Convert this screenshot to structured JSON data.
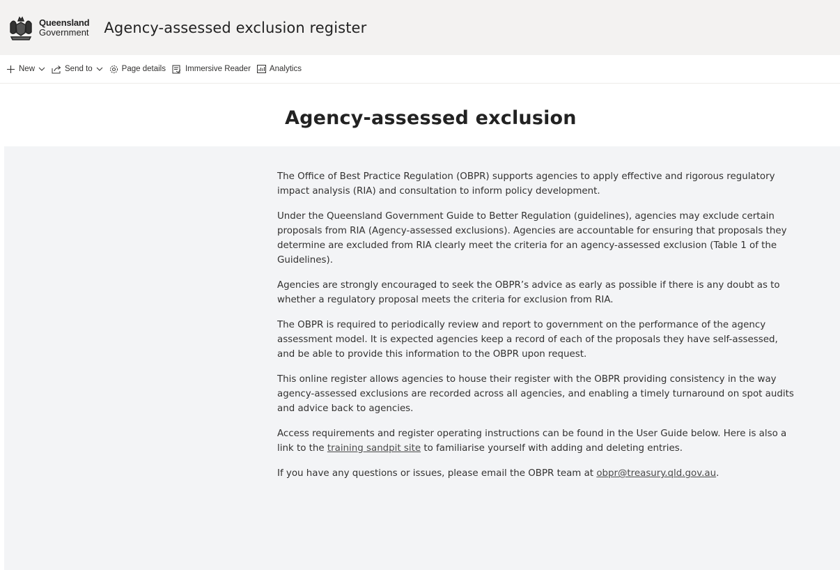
{
  "header": {
    "logo_line1": "Queensland",
    "logo_line2": "Government",
    "site_title": "Agency-assessed exclusion register"
  },
  "command_bar": {
    "new_label": "New",
    "send_to_label": "Send to",
    "page_details_label": "Page details",
    "immersive_reader_label": "Immersive Reader",
    "analytics_label": "Analytics"
  },
  "page": {
    "heading": "Agency-assessed exclusion",
    "paragraphs": [
      "The Office of Best Practice Regulation (OBPR) supports agencies to apply effective and rigorous regulatory impact analysis (RIA) and consultation to inform policy development.",
      "Under the Queensland Government Guide to Better Regulation (guidelines), agencies may exclude certain proposals from RIA (Agency-assessed exclusions). Agencies are accountable for ensuring that proposals they determine are excluded from RIA clearly meet the criteria for an agency-assessed exclusion (Table 1 of the Guidelines).",
      "Agencies are strongly encouraged to seek the OBPR’s advice as early as possible if there is any doubt as to whether a regulatory proposal meets the criteria for exclusion from RIA.",
      "The OBPR is required to periodically review and report to government on the performance of the agency assessment model. It is expected agencies keep a record of each of the proposals they have self-assessed, and be able to provide this information to the OBPR upon request.",
      "This online register allows agencies to house their register with the OBPR providing consistency in the way agency-assessed exclusions are recorded across all agencies, and enabling a timely turnaround on spot audits and advice back to agencies."
    ],
    "p6_text1": "Access requirements and register operating instructions can be found in the User Guide below. Here is also a link to the ",
    "p6_link": "training sandpit site",
    "p6_text2": " to familiarise yourself with adding and deleting entries.",
    "p7_text1": "If you have any questions or issues, please email the OBPR team at ",
    "p7_link": "obpr@treasury.qld.gov.au",
    "p7_text2": "."
  }
}
